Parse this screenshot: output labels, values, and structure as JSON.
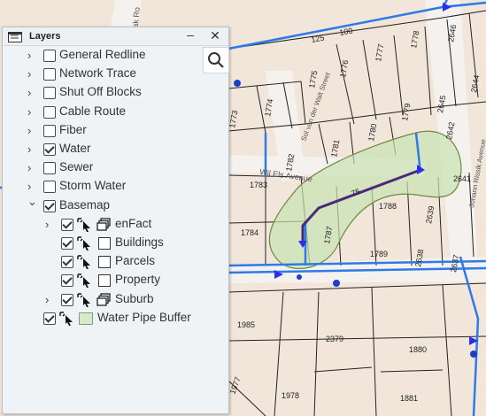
{
  "panel": {
    "title": "Layers",
    "minimize_label": "–",
    "close_label": "✕",
    "icons": {
      "layers": "layer-list-icon",
      "search": "search-icon"
    }
  },
  "layers": [
    {
      "label": "General Redline",
      "checked": false,
      "expandable": true
    },
    {
      "label": "Network Trace",
      "checked": false,
      "expandable": true
    },
    {
      "label": "Shut Off Blocks",
      "checked": false,
      "expandable": true
    },
    {
      "label": "Cable Route",
      "checked": false,
      "expandable": true
    },
    {
      "label": "Fiber",
      "checked": false,
      "expandable": true
    },
    {
      "label": "Water",
      "checked": true,
      "expandable": true
    },
    {
      "label": "Sewer",
      "checked": false,
      "expandable": true
    },
    {
      "label": "Storm Water",
      "checked": false,
      "expandable": true
    },
    {
      "label": "Basemap",
      "checked": true,
      "expanded": true
    }
  ],
  "basemap_children": [
    {
      "label": "enFact",
      "checked": true,
      "expandable": true,
      "icon": "group-layer-icon"
    },
    {
      "label": "Buildings",
      "checked": true,
      "icon": "square-symbol"
    },
    {
      "label": "Parcels",
      "checked": true,
      "icon": "square-symbol"
    },
    {
      "label": "Property",
      "checked": true,
      "icon": "square-symbol"
    },
    {
      "label": "Suburb",
      "checked": true,
      "expandable": true,
      "icon": "group-layer-icon"
    }
  ],
  "buffer_layer": {
    "label": "Water Pipe Buffer",
    "checked": true,
    "swatch_color": "#d5ebcb"
  },
  "map": {
    "parcel_labels": [
      "1778",
      "2646",
      "2644",
      "1777",
      "1776",
      "1775",
      "1774",
      "1773",
      "1779",
      "1780",
      "1781",
      "1782",
      "1783",
      "2645",
      "2642",
      "2641",
      "1788",
      "1784",
      "1787",
      "2639",
      "1789",
      "2638",
      "2637",
      "1985",
      "2379",
      "1880",
      "1977",
      "1978",
      "1881"
    ],
    "street_labels": [
      "Sol van der Walt Street",
      "Wil Els Avenue",
      "Johann Rissik Avenue",
      "Trak Ro"
    ],
    "pipe_labels": [
      "125",
      "100",
      "75"
    ],
    "colors": {
      "parcel_fill": "#f2e6da",
      "pipe": "#2d7be8",
      "selected_pipe": "#4a2a7a",
      "buffer": "#c7e3b2"
    }
  }
}
